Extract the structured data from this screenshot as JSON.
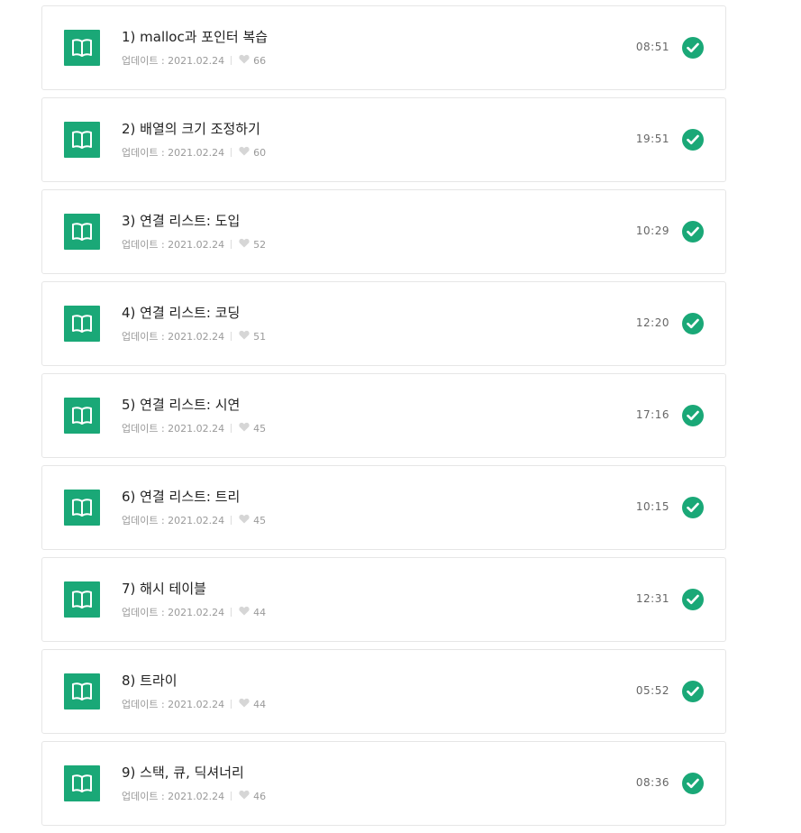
{
  "colors": {
    "accent": "#1aa877",
    "border": "#e6e6e6",
    "meta_text": "#9a9a9a"
  },
  "icons": {
    "lesson": "open-book-icon",
    "likes": "heart-icon",
    "status": "check-circle-icon"
  },
  "lessons": [
    {
      "title": "1) malloc과 포인터 복습",
      "updated": "업데이트 : 2021.02.24",
      "likes": "66",
      "duration": "08:51"
    },
    {
      "title": "2) 배열의 크기 조정하기",
      "updated": "업데이트 : 2021.02.24",
      "likes": "60",
      "duration": "19:51"
    },
    {
      "title": "3) 연결 리스트: 도입",
      "updated": "업데이트 : 2021.02.24",
      "likes": "52",
      "duration": "10:29"
    },
    {
      "title": "4) 연결 리스트: 코딩",
      "updated": "업데이트 : 2021.02.24",
      "likes": "51",
      "duration": "12:20"
    },
    {
      "title": "5) 연결 리스트: 시연",
      "updated": "업데이트 : 2021.02.24",
      "likes": "45",
      "duration": "17:16"
    },
    {
      "title": "6) 연결 리스트: 트리",
      "updated": "업데이트 : 2021.02.24",
      "likes": "45",
      "duration": "10:15"
    },
    {
      "title": "7) 해시 테이블",
      "updated": "업데이트 : 2021.02.24",
      "likes": "44",
      "duration": "12:31"
    },
    {
      "title": "8) 트라이",
      "updated": "업데이트 : 2021.02.24",
      "likes": "44",
      "duration": "05:52"
    },
    {
      "title": "9) 스택, 큐, 딕셔너리",
      "updated": "업데이트 : 2021.02.24",
      "likes": "46",
      "duration": "08:36"
    }
  ]
}
